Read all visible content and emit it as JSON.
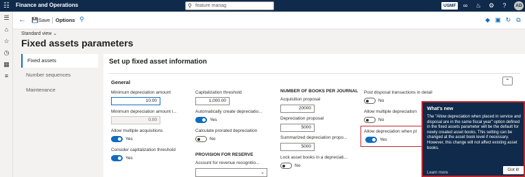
{
  "topbar": {
    "app_title": "Finance and Operations",
    "search_value": "feature manag",
    "company": "USMF",
    "avatar_initials": "AD"
  },
  "actionpane": {
    "save_label": "Save",
    "options_label": "Options"
  },
  "header": {
    "view_label": "Standard view",
    "page_title": "Fixed assets parameters"
  },
  "tabs": [
    {
      "label": "Fixed assets",
      "active": true
    },
    {
      "label": "Number sequences",
      "active": false
    },
    {
      "label": "Maintenance",
      "active": false
    }
  ],
  "main": {
    "section_title": "Set up fixed asset information",
    "fasttab_title": "General",
    "col1": {
      "min_dep_label": "Minimum depreciation amount",
      "min_dep_value": "10.00",
      "min_dep_i_label": "Minimum depreciation amount i...",
      "min_dep_i_value": "0.00",
      "allow_multi_acq_label": "Allow multiple acquisitions",
      "allow_multi_acq_value": "Yes",
      "consider_cap_label": "Consider capitalization threshold",
      "consider_cap_value": "Yes"
    },
    "col2": {
      "cap_threshold_label": "Capitalization threshold",
      "cap_threshold_value": "1,000.00",
      "auto_create_label": "Automatically create depreciatio...",
      "auto_create_value": "Yes",
      "calc_prorated_label": "Calculate prorated depreciation",
      "calc_prorated_value": "No",
      "provision_header": "PROVISION FOR RESERVE",
      "account_label": "Account for revenue recognitio..."
    },
    "col3": {
      "books_header": "NUMBER OF BOOKS PER JOURNAL",
      "acq_proposal_label": "Acquisition proposal",
      "acq_proposal_value": "20000",
      "dep_proposal_label": "Depreciation proposal",
      "dep_proposal_value": "5000",
      "sum_dep_label": "Summarized depreciation propo...",
      "sum_dep_value": "5000",
      "lock_books_label": "Lock asset books in a depreciati...",
      "lock_books_value": "No"
    },
    "col4": {
      "post_disposal_label": "Post disposal transactions in detail",
      "post_disposal_value": "No",
      "allow_multi_dep_label": "Allow multiple depreciation",
      "allow_multi_dep_value": "No",
      "allow_dep_placed_label": "Allow depreciation when pl",
      "allow_dep_placed_value": "Yes"
    }
  },
  "bubble": {
    "title": "What's new",
    "body": "The \"Allow depreciation when placed in service and disposal are in the same fiscal year\" option defined in the fixed assets parameter will be the default for newly created asset books. This setting can be changed at the asset book level if necessary. However, this change will not affect existing asset books.",
    "link": "Learn more",
    "button": "Got it!"
  }
}
